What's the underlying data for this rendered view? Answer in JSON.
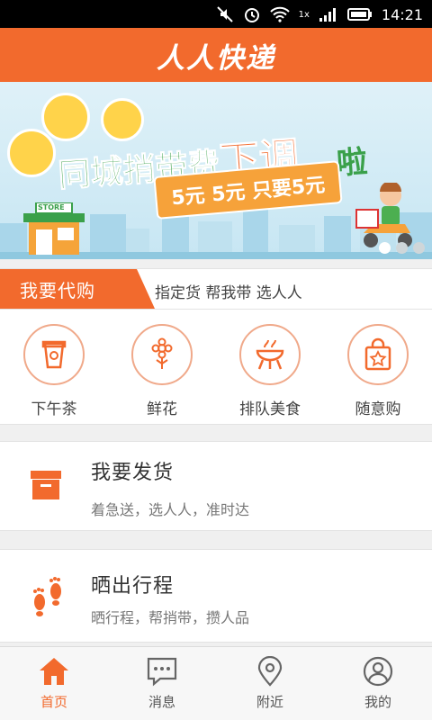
{
  "status_bar": {
    "time": "14:21",
    "network_label": "1x"
  },
  "header": {
    "title": "人人快递"
  },
  "banner": {
    "headline_part1": "同城捎带费",
    "headline_accent": "下调",
    "headline_part2": "啦",
    "price_text": "5元 5元 只要5元",
    "store_sign": "STORE",
    "slide_count": 3,
    "active_slide": 1
  },
  "purchase": {
    "tag_label": "我要代购",
    "tagline": "指定货 帮我带 选人人",
    "items": [
      {
        "label": "下午茶",
        "icon": "cup-icon"
      },
      {
        "label": "鲜花",
        "icon": "flower-icon"
      },
      {
        "label": "排队美食",
        "icon": "food-stall-icon"
      },
      {
        "label": "随意购",
        "icon": "shopping-bag-icon"
      }
    ]
  },
  "cards": [
    {
      "title": "我要发货",
      "desc": "着急送，选人人，准时达",
      "icon": "box-icon"
    },
    {
      "title": "晒出行程",
      "desc": "晒行程，帮捎带，攒人品",
      "icon": "footprints-icon"
    }
  ],
  "nav": {
    "items": [
      {
        "label": "首页",
        "icon": "home-icon",
        "active": true
      },
      {
        "label": "消息",
        "icon": "message-icon",
        "active": false
      },
      {
        "label": "附近",
        "icon": "location-pin-icon",
        "active": false
      },
      {
        "label": "我的",
        "icon": "user-icon",
        "active": false
      }
    ]
  },
  "colors": {
    "brand": "#f26a2d",
    "icon_outline": "#f0a98a",
    "banner_green": "#3aa04a"
  }
}
